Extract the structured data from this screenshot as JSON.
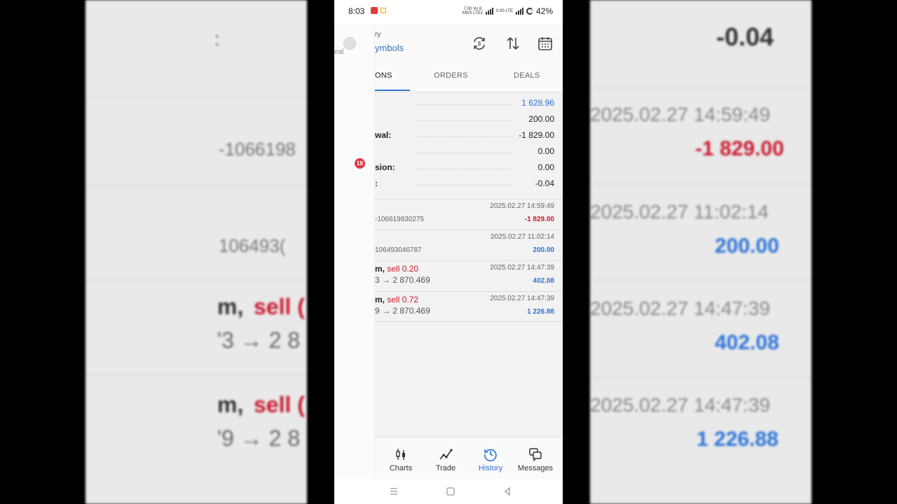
{
  "status_bar": {
    "time": "8:03",
    "app_icon_colors": [
      "#e53935",
      "#f2a900"
    ],
    "network_top": "7.00 Vo 8",
    "network_bottom": "KB/S LTE2",
    "wifi_label": "0.00 LTE",
    "battery": "42%",
    "icons": [
      "signal-bars-icon",
      "battery-ring-icon"
    ]
  },
  "header": {
    "title_partial": "ry",
    "subtitle_partial": "ymbols",
    "icons": [
      "sync-icon",
      "sort-icon",
      "calendar-icon"
    ],
    "accent": "#2b74d7"
  },
  "tabs": [
    {
      "label": "ONS",
      "active": true
    },
    {
      "label": "ORDERS",
      "active": false
    },
    {
      "label": "DEALS",
      "active": false
    }
  ],
  "summary": [
    {
      "label": "",
      "value": "1 628.96",
      "color": "#2b74d7"
    },
    {
      "label": "",
      "value": "200.00",
      "color": "#222222"
    },
    {
      "label": "wal:",
      "value": "-1 829.00",
      "color": "#222222"
    },
    {
      "label": "",
      "value": "0.00",
      "color": "#222222"
    },
    {
      "label": "sion:",
      "value": "0.00",
      "color": "#222222"
    },
    {
      "label": ":",
      "value": "-0.04",
      "color": "#222222"
    }
  ],
  "deals": [
    {
      "id": "-106619830275",
      "time": "2025.02.27 14:59:49",
      "amount": "-1 829.00",
      "type": "neg"
    },
    {
      "id": "106493046787",
      "time": "2025.02.27 11:02:14",
      "amount": "200.00",
      "type": "pos"
    },
    {
      "symbol": "m,",
      "side": "sell 0.20",
      "prices_left": "3",
      "prices_right": "2 870.469",
      "time": "2025.02.27 14:47:39",
      "amount": "402.08",
      "type": "pos"
    },
    {
      "symbol": "m,",
      "side": "sell 0.72",
      "prices_left": "9",
      "prices_right": "2 870.469",
      "time": "2025.02.27 14:47:39",
      "amount": "1 226.88",
      "type": "pos"
    }
  ],
  "bottom_nav": [
    {
      "label": "Charts",
      "icon": "candlestick-icon",
      "active": false
    },
    {
      "label": "Trade",
      "icon": "trend-line-icon",
      "active": false
    },
    {
      "label": "History",
      "icon": "history-clock-icon",
      "active": true
    },
    {
      "label": "Messages",
      "icon": "messages-icon",
      "active": false
    }
  ],
  "drawer": {
    "text_partial": "eal",
    "badge": "18",
    "badge_color": "#e0384a"
  },
  "background_left": {
    "colon": ":",
    "id": "-1066198",
    "id2": "106493(",
    "sym1": "m,",
    "side1": "sell (",
    "price1": "'3 → 2 8",
    "sym2": "m,",
    "side2": "sell (",
    "price2": "'9 → 2 8"
  },
  "background_right": {
    "v0": "-0.04",
    "t1": "2025.02.27 14:59:49",
    "a1": "-1 829.00",
    "t2": "2025.02.27 11:02:14",
    "a2": "200.00",
    "t3": "2025.02.27 14:47:39",
    "a3": "402.08",
    "t4": "2025.02.27 14:47:39",
    "a4": "1 226.88"
  }
}
